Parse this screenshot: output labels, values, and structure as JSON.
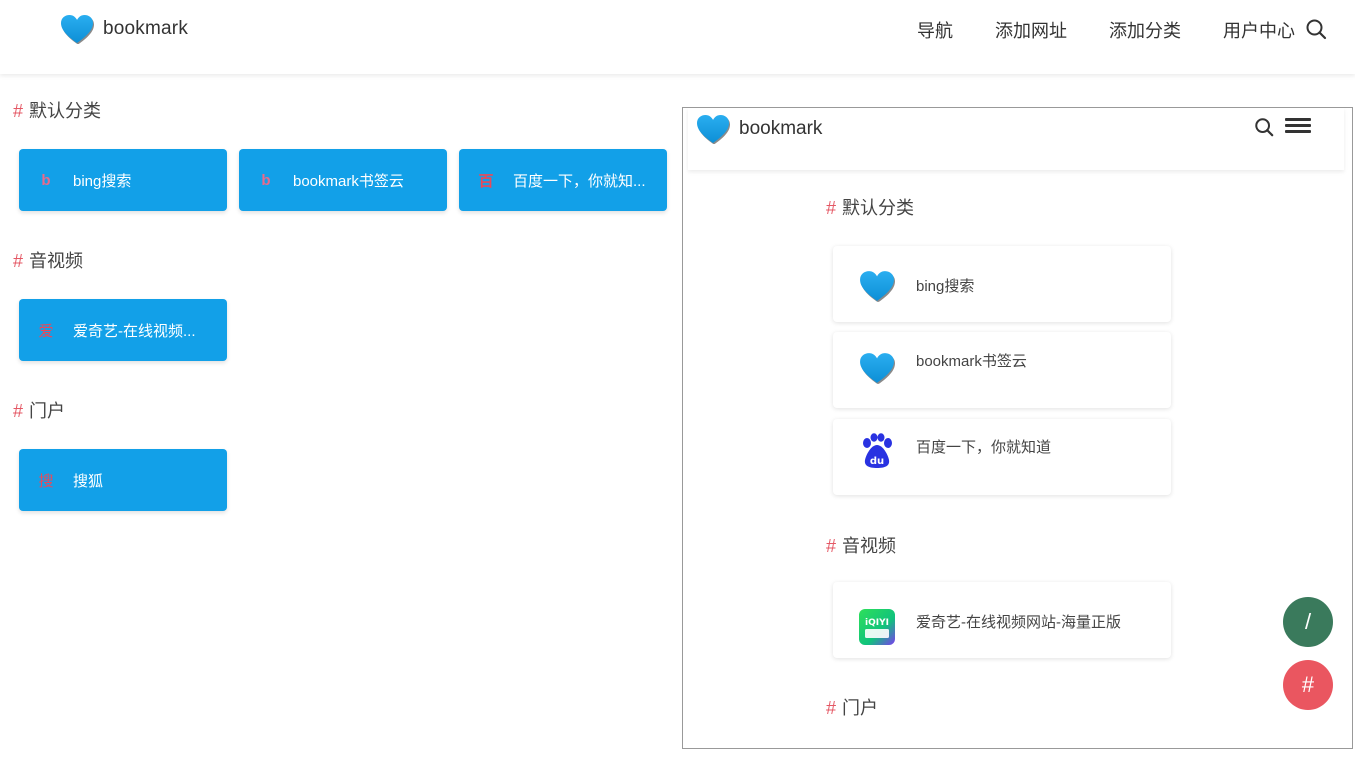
{
  "header": {
    "logo_text": "bookmark",
    "nav": [
      "导航",
      "添加网址",
      "添加分类",
      "用户中心"
    ]
  },
  "sections": [
    {
      "title": "默认分类",
      "links": [
        {
          "icon_char": "b",
          "title": "bing搜索"
        },
        {
          "icon_char": "b",
          "title": "bookmark书签云"
        },
        {
          "icon_char": "百",
          "title": "百度一下，你就知..."
        }
      ]
    },
    {
      "title": "音视频",
      "links": [
        {
          "icon_char": "爱",
          "title": "爱奇艺-在线视频..."
        }
      ]
    },
    {
      "title": "门户",
      "links": [
        {
          "icon_char": "搜",
          "title": "搜狐"
        }
      ]
    }
  ],
  "preview": {
    "logo_text": "bookmark",
    "sections": [
      {
        "title": "默认分类",
        "links": [
          {
            "icon": "heart-icon",
            "title": "bing搜索"
          },
          {
            "icon": "heart-icon",
            "title": "bookmark书签云"
          },
          {
            "icon": "baidu-paw-icon",
            "title": "百度一下，你就知道"
          }
        ]
      },
      {
        "title": "音视频",
        "links": [
          {
            "icon": "iqiyi-icon",
            "title": "爱奇艺-在线视频网站-海量正版"
          }
        ]
      },
      {
        "title": "门户",
        "links": []
      }
    ]
  },
  "fab": {
    "slash_label": "/",
    "hash_label": "#"
  },
  "hash_symbol": "#",
  "colors": {
    "accent": "#12a0e8",
    "hash": "#e45865",
    "fab_green": "#3a7a5c",
    "fab_red": "#ea5660"
  }
}
